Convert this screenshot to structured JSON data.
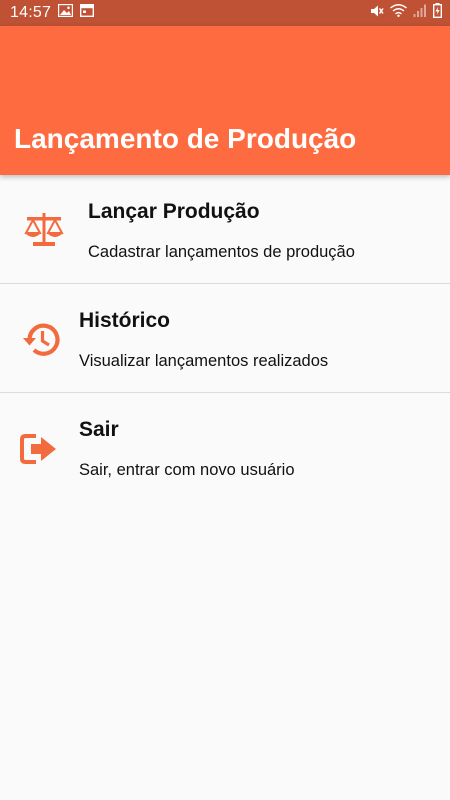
{
  "status_bar": {
    "time": "14:57",
    "left_icons": [
      "image-icon",
      "calendar-icon"
    ],
    "right_icons": [
      "mute-icon",
      "wifi-icon",
      "signal-icon",
      "battery-charging-icon"
    ]
  },
  "app_bar": {
    "title": "Lançamento de Produção",
    "color": "#ff6b40"
  },
  "menu": {
    "items": [
      {
        "icon": "scale-icon",
        "title": "Lançar Produção",
        "subtitle": "Cadastrar lançamentos de produção"
      },
      {
        "icon": "history-icon",
        "title": "Histórico",
        "subtitle": "Visualizar lançamentos realizados"
      },
      {
        "icon": "exit-icon",
        "title": "Sair",
        "subtitle": "Sair, entrar com novo usuário"
      }
    ]
  },
  "colors": {
    "accent": "#ff6b40",
    "status_bar": "#bf5134",
    "icon": "#f26b3f",
    "background": "#fafafa"
  }
}
